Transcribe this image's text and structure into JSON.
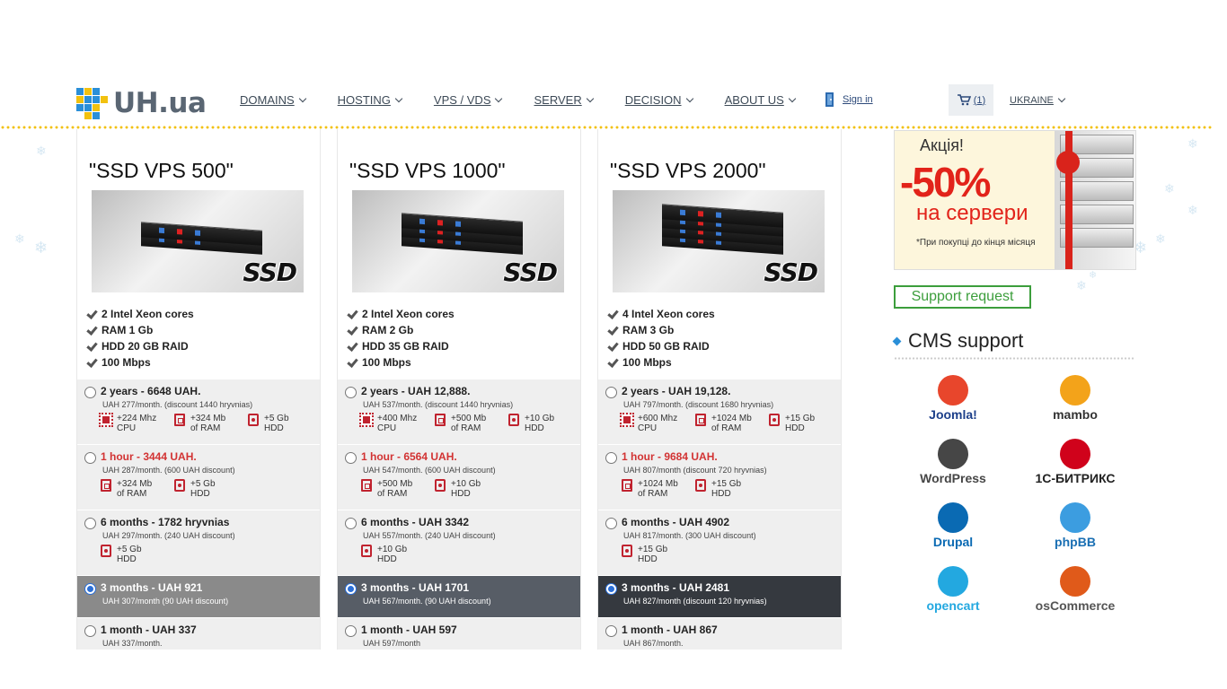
{
  "header": {
    "logo_text": "UH.ua",
    "nav": [
      "DOMAINS",
      "HOSTING",
      "VPS / VDS",
      "SERVER",
      "DECISION",
      "ABOUT US"
    ],
    "sign_in": "Sign in",
    "cart_count": "(1)",
    "country": "UKRAINE"
  },
  "plans": [
    {
      "name": "\"SSD VPS 500\"",
      "ssd_label": "SSD",
      "features": [
        "2 Intel Xeon cores",
        "RAM 1 Gb",
        "HDD 20 GB RAID",
        "100 Mbps"
      ],
      "options": [
        {
          "title": "2 years - 6648 UAH.",
          "sub": "UAH 277/month. (discount 1440 hryvnias)",
          "red": false,
          "selected": false,
          "bonuses": [
            {
              "icon": "cpu-icon",
              "l1": "+224 Mhz",
              "l2": "CPU"
            },
            {
              "icon": "ram-icon",
              "l1": "+324 Mb",
              "l2": "of RAM"
            },
            {
              "icon": "hdd-icon",
              "l1": "+5 Gb",
              "l2": "HDD"
            }
          ]
        },
        {
          "title": "1 hour - 3444 UAH.",
          "sub": "UAH 287/month. (600 UAH discount)",
          "red": true,
          "selected": false,
          "bonuses": [
            {
              "icon": "ram-icon",
              "l1": "+324 Mb",
              "l2": "of RAM"
            },
            {
              "icon": "hdd-icon",
              "l1": "+5 Gb",
              "l2": "HDD"
            }
          ]
        },
        {
          "title": "6 months - 1782 hryvnias",
          "sub": "UAH 297/month. (240 UAH discount)",
          "red": false,
          "selected": false,
          "bonuses": [
            {
              "icon": "hdd-icon",
              "l1": "+5 Gb",
              "l2": "HDD"
            }
          ]
        },
        {
          "title": "3 months - UAH 921",
          "sub": "UAH 307/month (90 UAH discount)",
          "red": false,
          "selected": true,
          "bonuses": []
        },
        {
          "title": "1 month - UAH 337",
          "sub": "UAH 337/month.",
          "red": false,
          "selected": false,
          "bonuses": []
        }
      ]
    },
    {
      "name": "\"SSD VPS 1000\"",
      "ssd_label": "SSD",
      "features": [
        "2 Intel Xeon cores",
        "RAM 2 Gb",
        "HDD 35 GB RAID",
        "100 Mbps"
      ],
      "options": [
        {
          "title": "2 years - UAH 12,888.",
          "sub": "UAH 537/month. (discount 1440 hryvnias)",
          "red": false,
          "selected": false,
          "bonuses": [
            {
              "icon": "cpu-icon",
              "l1": "+400 Mhz",
              "l2": "CPU"
            },
            {
              "icon": "ram-icon",
              "l1": "+500 Mb",
              "l2": "of RAM"
            },
            {
              "icon": "hdd-icon",
              "l1": "+10 Gb",
              "l2": "HDD"
            }
          ]
        },
        {
          "title": "1 hour - 6564 UAH.",
          "sub": "UAH 547/month. (600 UAH discount)",
          "red": true,
          "selected": false,
          "bonuses": [
            {
              "icon": "ram-icon",
              "l1": "+500 Mb",
              "l2": "of RAM"
            },
            {
              "icon": "hdd-icon",
              "l1": "+10 Gb",
              "l2": "HDD"
            }
          ]
        },
        {
          "title": "6 months - UAH 3342",
          "sub": "UAH 557/month. (240 UAH discount)",
          "red": false,
          "selected": false,
          "bonuses": [
            {
              "icon": "hdd-icon",
              "l1": "+10 Gb",
              "l2": "HDD"
            }
          ]
        },
        {
          "title": "3 months - UAH 1701",
          "sub": "UAH 567/month. (90 UAH discount)",
          "red": false,
          "selected": true,
          "bonuses": []
        },
        {
          "title": "1 month - UAH 597",
          "sub": "UAH 597/month",
          "red": false,
          "selected": false,
          "bonuses": []
        }
      ]
    },
    {
      "name": "\"SSD VPS 2000\"",
      "ssd_label": "SSD",
      "features": [
        "4 Intel Xeon cores",
        "RAM 3 Gb",
        "HDD 50 GB RAID",
        "100 Mbps"
      ],
      "options": [
        {
          "title": "2 years - UAH 19,128.",
          "sub": "UAH 797/month. (discount 1680 hryvnias)",
          "red": false,
          "selected": false,
          "bonuses": [
            {
              "icon": "cpu-icon",
              "l1": "+600 Mhz",
              "l2": "CPU"
            },
            {
              "icon": "ram-icon",
              "l1": "+1024 Mb",
              "l2": "of RAM"
            },
            {
              "icon": "hdd-icon",
              "l1": "+15 Gb",
              "l2": "HDD"
            }
          ]
        },
        {
          "title": "1 hour - 9684 UAH.",
          "sub": "UAH 807/month (discount 720 hryvnias)",
          "red": true,
          "selected": false,
          "bonuses": [
            {
              "icon": "ram-icon",
              "l1": "+1024 Mb",
              "l2": "of RAM"
            },
            {
              "icon": "hdd-icon",
              "l1": "+15 Gb",
              "l2": "HDD"
            }
          ]
        },
        {
          "title": "6 months - UAH 4902",
          "sub": "UAH 817/month. (300 UAH discount)",
          "red": false,
          "selected": false,
          "bonuses": [
            {
              "icon": "hdd-icon",
              "l1": "+15 Gb",
              "l2": "HDD"
            }
          ]
        },
        {
          "title": "3 months - UAH 2481",
          "sub": "UAH 827/month (discount 120 hryvnias)",
          "red": false,
          "selected": true,
          "bonuses": []
        },
        {
          "title": "1 month - UAH 867",
          "sub": "UAH 867/month.",
          "red": false,
          "selected": false,
          "bonuses": []
        }
      ]
    }
  ],
  "sidebar": {
    "promo": {
      "title": "Акція!",
      "percent": "-50%",
      "subtitle": "на сервери",
      "note": "*При покупці до кінця місяця"
    },
    "support_button": "Support request",
    "cms_heading": "CMS support",
    "cms": [
      {
        "name": "Joomla!",
        "color": "#1c3f8a",
        "icon": "joomla-icon",
        "icon_color": "#e8462c"
      },
      {
        "name": "mambo",
        "color": "#333333",
        "icon": "mambo-icon",
        "icon_color": "#f3a31a"
      },
      {
        "name": "WordPress",
        "color": "#464646",
        "icon": "wordpress-icon",
        "icon_color": "#464646"
      },
      {
        "name": "1С-БИТРИКС",
        "color": "#222222",
        "icon": "bitrix-icon",
        "icon_color": "#d0021b"
      },
      {
        "name": "Drupal",
        "color": "#0a6ab3",
        "icon": "drupal-icon",
        "icon_color": "#0a6ab3"
      },
      {
        "name": "phpBB",
        "color": "#1a6fb3",
        "icon": "phpbb-icon",
        "icon_color": "#3c9de0"
      },
      {
        "name": "opencart",
        "color": "#23a8e0",
        "icon": "opencart-icon",
        "icon_color": "#23a8e0"
      },
      {
        "name": "osCommerce",
        "color": "#555555",
        "icon": "oscommerce-icon",
        "icon_color": "#e05a1a"
      }
    ]
  },
  "colors": {
    "selected_option_bg": [
      "#8a8a8a",
      "#575d66",
      "#35393f"
    ],
    "accent_red": "#d23333",
    "support_green": "#3c9e3c",
    "link_blue": "#2d4a7a"
  }
}
